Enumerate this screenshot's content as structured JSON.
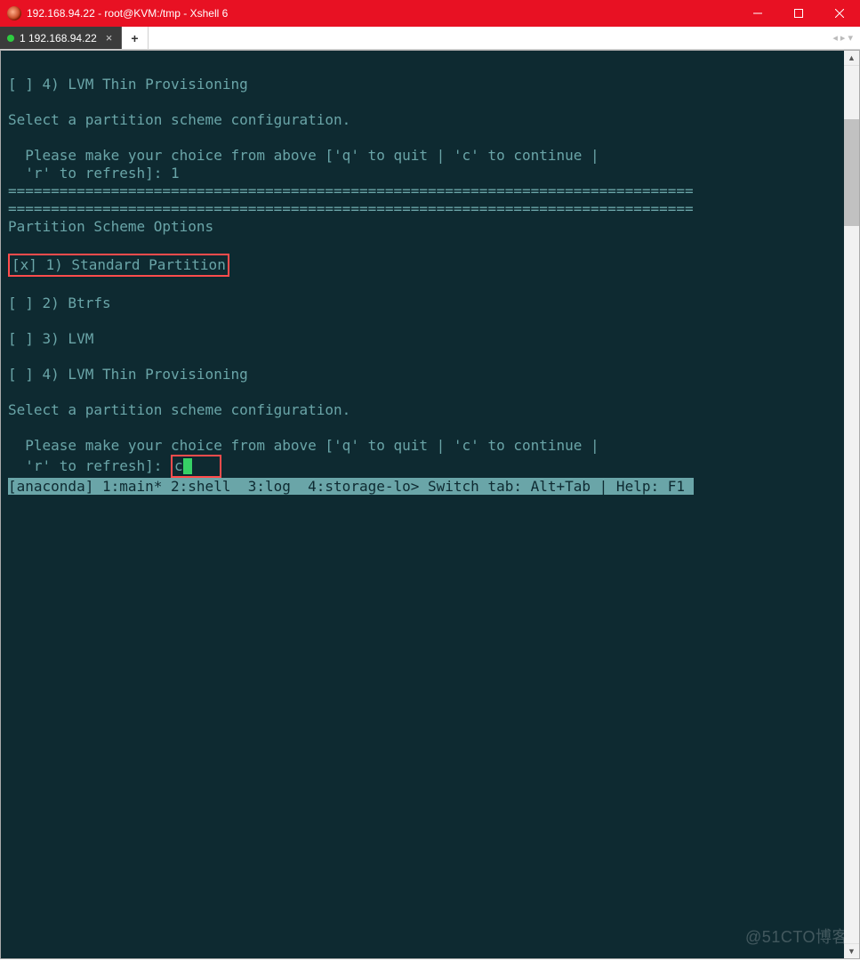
{
  "window": {
    "title": "192.168.94.22 - root@KVM:/tmp - Xshell 6"
  },
  "tabs": {
    "active_label": "1 192.168.94.22",
    "add_label": "+"
  },
  "terminal": {
    "lines": [
      "",
      "[ ] 4) LVM Thin Provisioning",
      "",
      "Select a partition scheme configuration.",
      "",
      "  Please make your choice from above ['q' to quit | 'c' to continue |",
      "  'r' to refresh]: 1",
      "================================================================================",
      "================================================================================",
      "Partition Scheme Options",
      "",
      "[x] 1) Standard Partition",
      "",
      "[ ] 2) Btrfs",
      "",
      "[ ] 3) LVM",
      "",
      "[ ] 4) LVM Thin Provisioning",
      "",
      "Select a partition scheme configuration.",
      "",
      "  Please make your choice from above ['q' to quit | 'c' to continue |",
      "  'r' to refresh]: c",
      "[anaconda] 1:main* 2:shell  3:log  4:storage-lo> Switch tab: Alt+Tab | Help: F1 "
    ],
    "cursor_input": "c"
  },
  "watermark": "@51CTO博客"
}
